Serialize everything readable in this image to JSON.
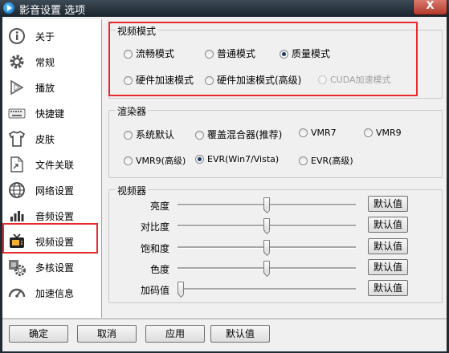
{
  "window": {
    "title": "影音设置 选项",
    "close_glyph": "X"
  },
  "sidebar": {
    "items": [
      {
        "label": "关于",
        "icon": "info-icon"
      },
      {
        "label": "常规",
        "icon": "gear-icon"
      },
      {
        "label": "播放",
        "icon": "play-icon"
      },
      {
        "label": "快捷键",
        "icon": "keyboard-icon"
      },
      {
        "label": "皮肤",
        "icon": "shirt-icon"
      },
      {
        "label": "文件关联",
        "icon": "file-icon"
      },
      {
        "label": "网络设置",
        "icon": "globe-icon"
      },
      {
        "label": "音频设置",
        "icon": "audio-icon"
      },
      {
        "label": "视频设置",
        "icon": "tv-icon",
        "selected": true
      },
      {
        "label": "多核设置",
        "icon": "multicore-icon"
      },
      {
        "label": "加速信息",
        "icon": "speedometer-icon"
      }
    ]
  },
  "video_mode": {
    "title": "视频模式",
    "options": [
      {
        "label": "流畅模式",
        "checked": false,
        "disabled": false
      },
      {
        "label": "普通模式",
        "checked": false,
        "disabled": false
      },
      {
        "label": "质量模式",
        "checked": true,
        "disabled": false
      },
      {
        "label": "硬件加速模式",
        "checked": false,
        "disabled": false
      },
      {
        "label": "硬件加速模式(高级)",
        "checked": false,
        "disabled": false
      },
      {
        "label": "CUDA加速模式",
        "checked": false,
        "disabled": true
      }
    ]
  },
  "renderer": {
    "title": "渲染器",
    "options": [
      {
        "label": "系统默认",
        "checked": false
      },
      {
        "label": "覆盖混合器(推荐)",
        "checked": false
      },
      {
        "label": "VMR7",
        "checked": false
      },
      {
        "label": "VMR9",
        "checked": false
      },
      {
        "label": "VMR9(高级)",
        "checked": false
      },
      {
        "label": "EVR(Win7/Vista)",
        "checked": true
      },
      {
        "label": "EVR(高级)",
        "checked": false
      }
    ]
  },
  "video_processor": {
    "title": "视频器",
    "default_label": "默认值",
    "sliders": [
      {
        "label": "亮度",
        "value": 0.5
      },
      {
        "label": "对比度",
        "value": 0.5
      },
      {
        "label": "饱和度",
        "value": 0.5
      },
      {
        "label": "色度",
        "value": 0.5
      },
      {
        "label": "加码值",
        "value": 0.0
      }
    ]
  },
  "buttons": {
    "ok": "确定",
    "cancel": "取消",
    "apply": "应用",
    "defaults": "默认值"
  },
  "colors": {
    "highlight": "#e8282c"
  }
}
